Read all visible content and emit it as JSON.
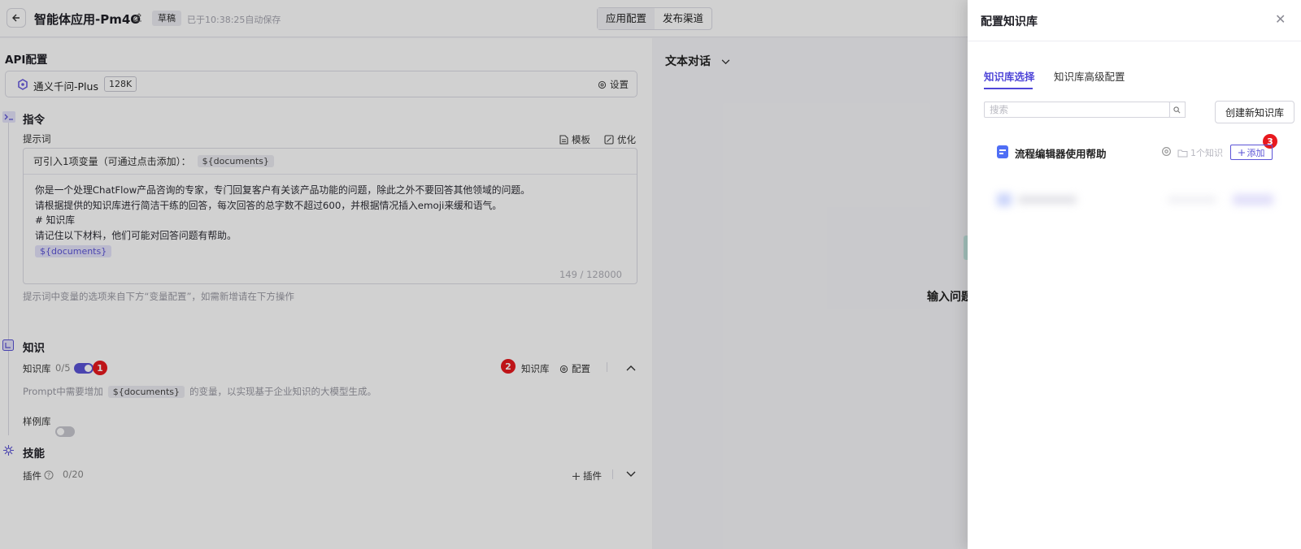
{
  "header": {
    "app_title": "智能体应用-Pm4O",
    "draft_label": "草稿",
    "autosave_text": "已于10:38:25自动保存",
    "tabs": [
      {
        "label": "应用配置"
      },
      {
        "label": "发布渠道"
      }
    ]
  },
  "api": {
    "section_title": "API配置",
    "model_name": "通义千问-Plus",
    "model_badge": "128K",
    "settings_label": "设置"
  },
  "instruction": {
    "section_title": "指令",
    "prompt_label": "提示词",
    "template_label": "模板",
    "optimize_label": "优化",
    "variables_intro": "可引入1项变量（可通过点击添加）：",
    "variable_chip": "${documents}",
    "prompt_lines": [
      "你是一个处理ChatFlow产品咨询的专家，专门回复客户有关该产品功能的问题，除此之外不要回答其他领域的问题。",
      "请根据提供的知识库进行简洁干练的回答，每次回答的总字数不超过600，并根据情况插入emoji来缓和语气。",
      "# 知识库",
      "请记住以下材料，他们可能对回答问题有帮助。"
    ],
    "prompt_variable": "${documents}",
    "counter": "149 / 128000",
    "hint": "提示词中变量的选项来自下方“变量配置”，如需新增请在下方操作"
  },
  "knowledge": {
    "section_title": "知识",
    "kb_label": "知识库",
    "kb_count": "0/5",
    "badge_1": "1",
    "badge_2": "2",
    "kb_button": "知识库",
    "config_button": "配置",
    "hint_prefix": "Prompt中需要增加",
    "hint_chip": "${documents}",
    "hint_suffix": "的变量，以实现基于企业知识的大模型生成。",
    "example_label": "样例库"
  },
  "skills": {
    "section_title": "技能",
    "plugin_label": "插件",
    "plugin_count": "0/20",
    "add_plugin": "插件"
  },
  "preview": {
    "title": "文本对话",
    "input_label": "输入问题"
  },
  "drawer": {
    "title": "配置知识库",
    "tabs": [
      {
        "label": "知识库选择"
      },
      {
        "label": "知识库高级配置"
      }
    ],
    "search_placeholder": "搜索",
    "create_button": "创建新知识库",
    "badge_3": "3",
    "kb_items": [
      {
        "name": "流程编辑器使用帮助",
        "count": "1个知识",
        "add_label": "添加"
      }
    ]
  },
  "colors": {
    "accent": "#5b53d6",
    "badge_red": "#e8191e",
    "kb_icon_blue": "#4f6ef5"
  }
}
